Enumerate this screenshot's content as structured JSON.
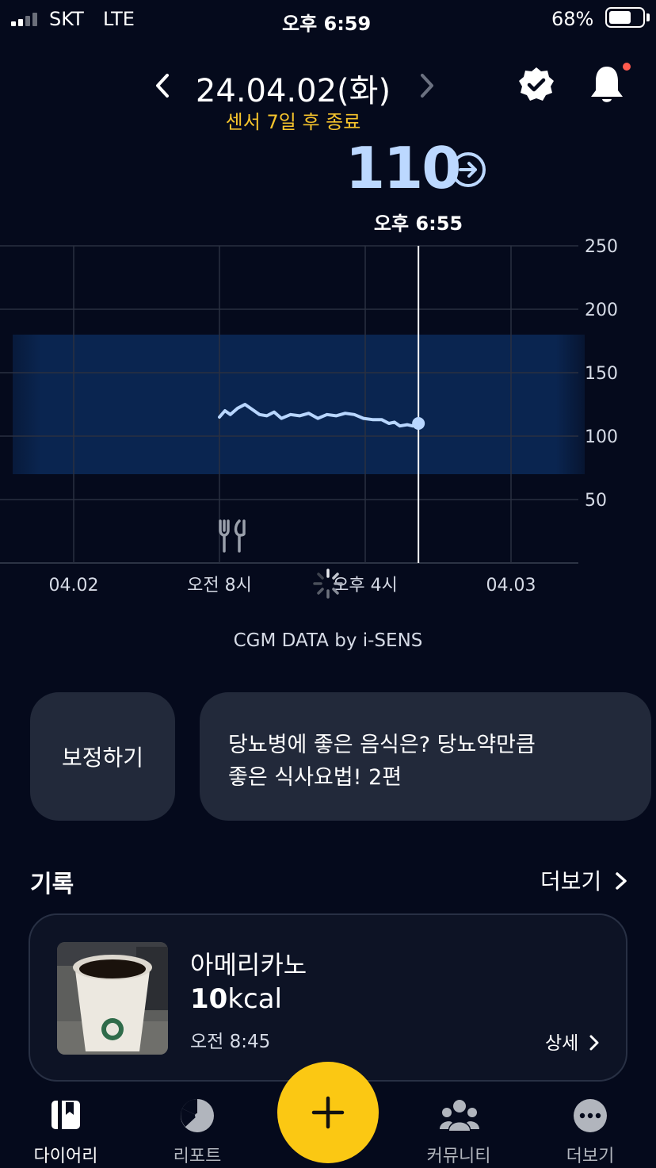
{
  "status_bar": {
    "carrier": "SKT",
    "network": "LTE",
    "time": "오후 6:59",
    "battery": "68%",
    "battery_level": 0.68
  },
  "header": {
    "date": "24.04.02(화)",
    "sensor_notice": "센서 7일 후 종료",
    "glucose_value": "110",
    "glucose_time": "오후 6:55",
    "accent_color": "#bcd8ff",
    "notice_color": "#f6c42c",
    "icons": [
      "chevron-left-icon",
      "chevron-right-icon",
      "verified-badge-icon",
      "bell-icon",
      "arrow-right-circle-icon"
    ]
  },
  "chart_data": {
    "type": "line",
    "y_ticks": [
      "250",
      "200",
      "150",
      "100",
      "50"
    ],
    "ylim": [
      0,
      250
    ],
    "x_ticks": [
      "04.02",
      "오전 8시",
      "오후 4시",
      "04.03"
    ],
    "target_range": [
      70,
      180
    ],
    "grid": true,
    "current_value": 110,
    "series": [
      {
        "values": [
          {
            "h": 8.0,
            "y": 115
          },
          {
            "h": 8.3,
            "y": 120
          },
          {
            "h": 8.6,
            "y": 117
          },
          {
            "h": 9.0,
            "y": 122
          },
          {
            "h": 9.4,
            "y": 125
          },
          {
            "h": 9.8,
            "y": 121
          },
          {
            "h": 10.2,
            "y": 117
          },
          {
            "h": 10.6,
            "y": 116
          },
          {
            "h": 11.0,
            "y": 119
          },
          {
            "h": 11.4,
            "y": 114
          },
          {
            "h": 11.9,
            "y": 117
          },
          {
            "h": 12.4,
            "y": 116
          },
          {
            "h": 12.9,
            "y": 118
          },
          {
            "h": 13.4,
            "y": 114
          },
          {
            "h": 13.9,
            "y": 117
          },
          {
            "h": 14.4,
            "y": 116
          },
          {
            "h": 14.9,
            "y": 118
          },
          {
            "h": 15.4,
            "y": 117
          },
          {
            "h": 15.9,
            "y": 114
          },
          {
            "h": 16.4,
            "y": 113
          },
          {
            "h": 16.9,
            "y": 113
          },
          {
            "h": 17.3,
            "y": 110
          },
          {
            "h": 17.6,
            "y": 111
          },
          {
            "h": 17.9,
            "y": 108
          },
          {
            "h": 18.3,
            "y": 109
          },
          {
            "h": 18.6,
            "y": 108
          },
          {
            "h": 18.92,
            "y": 110
          }
        ]
      }
    ],
    "colors": {
      "line": "#b8d6ff",
      "target_band": "#0a2550"
    },
    "markers": [
      "meal-icon"
    ]
  },
  "credit": "CGM DATA by i-SENS",
  "cards": {
    "calibrate": "보정하기",
    "article_line1": "당뇨병에 좋은 음식은? 당뇨약만큼",
    "article_line2": "좋은 식사요법! 2편"
  },
  "records": {
    "title": "기록",
    "more": "더보기",
    "items": [
      {
        "name": "아메리카노",
        "kcal_value": "10",
        "kcal_unit": "kcal",
        "time": "오전 8:45",
        "detail": "상세"
      }
    ]
  },
  "nav": {
    "items": [
      {
        "label": "다이어리",
        "icon": "diary-icon",
        "active": true
      },
      {
        "label": "리포트",
        "icon": "report-icon",
        "active": false
      },
      {
        "label": "add-button",
        "icon": "plus-icon",
        "active": false
      },
      {
        "label": "커뮤니티",
        "icon": "community-icon",
        "active": false
      },
      {
        "label": "더보기",
        "icon": "more-icon",
        "active": false
      }
    ],
    "fab_color": "#fbc813"
  }
}
